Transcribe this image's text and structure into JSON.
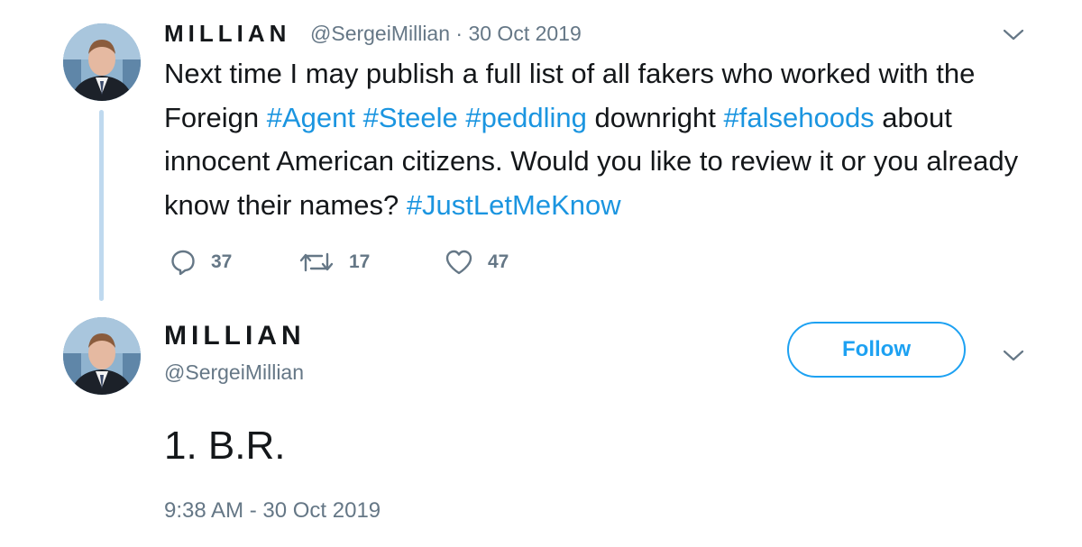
{
  "tweet1": {
    "display_name": "MILLIAN",
    "handle_and_date": "@SergeiMillian · 30 Oct 2019",
    "text_segments": [
      {
        "text": "Next time I may publish a full list of all fakers who worked with the Foreign ",
        "hashtag": false
      },
      {
        "text": "#Agent",
        "hashtag": true
      },
      {
        "text": " ",
        "hashtag": false
      },
      {
        "text": "#Steele",
        "hashtag": true
      },
      {
        "text": " ",
        "hashtag": false
      },
      {
        "text": "#peddling",
        "hashtag": true
      },
      {
        "text": " downright ",
        "hashtag": false
      },
      {
        "text": "#falsehoods",
        "hashtag": true
      },
      {
        "text": " about innocent American citizens. Would you like to review it or you already know their names? ",
        "hashtag": false
      },
      {
        "text": "#JustLetMeKnow",
        "hashtag": true
      }
    ],
    "actions": {
      "replies": "37",
      "retweets": "17",
      "likes": "47"
    }
  },
  "tweet2": {
    "display_name": "MILLIAN",
    "handle": "@SergeiMillian",
    "follow_label": "Follow",
    "text": "1. B.R.",
    "timestamp": "9:38 AM - 30 Oct 2019"
  },
  "icons": {
    "reply": "reply-icon",
    "retweet": "retweet-icon",
    "like": "heart-icon",
    "menu": "chevron-down-icon"
  },
  "colors": {
    "accent": "#1da1f2",
    "hashtag": "#1b95e0",
    "secondary_text": "#657786",
    "thread_line": "#bfd9ef"
  }
}
